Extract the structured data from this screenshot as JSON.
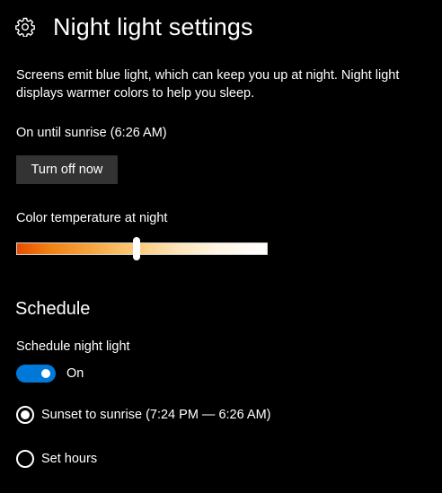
{
  "header": {
    "icon": "gear-icon",
    "title": "Night light settings"
  },
  "description": "Screens emit blue light, which can keep you up at night. Night light displays warmer colors to help you sleep.",
  "status": "On until sunrise (6:26 AM)",
  "turn_off_button": "Turn off now",
  "color_temperature": {
    "label": "Color temperature at night",
    "value_fraction": 0.48,
    "gradient_colors": [
      "#e84b00",
      "#f6a13a",
      "#fbc774",
      "#fff4e4",
      "#ffffff"
    ]
  },
  "schedule": {
    "section_title": "Schedule",
    "toggle_label": "Schedule night light",
    "toggle_state": "On",
    "toggle_on": true,
    "accent_color": "#0078d7",
    "options": [
      {
        "label": "Sunset to sunrise (7:24 PM — 6:26 AM)",
        "selected": true
      },
      {
        "label": "Set hours",
        "selected": false
      }
    ]
  }
}
